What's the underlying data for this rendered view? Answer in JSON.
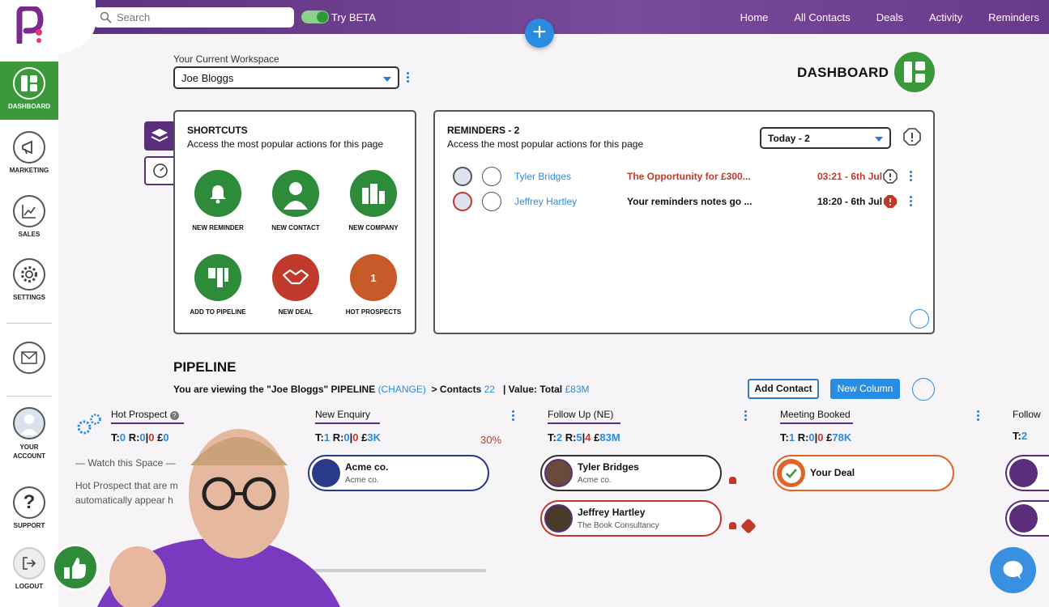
{
  "topbar": {
    "search_placeholder": "Search",
    "beta_label": "Try BETA",
    "nav": [
      "Home",
      "All Contacts",
      "Deals",
      "Activity",
      "Reminders"
    ],
    "add_label": "+"
  },
  "sidebar": {
    "items": [
      {
        "label": "DASHBOARD",
        "icon": "dashboard-icon",
        "active": true
      },
      {
        "label": "MARKETING",
        "icon": "megaphone-icon"
      },
      {
        "label": "SALES",
        "icon": "chart-line-icon"
      },
      {
        "label": "SETTINGS",
        "icon": "gear-icon"
      },
      {
        "label": "",
        "icon": "mail-icon"
      },
      {
        "label": "YOUR ACCOUNT",
        "icon": "avatar-icon"
      },
      {
        "label": "SUPPORT",
        "icon": "question-icon"
      },
      {
        "label": "LOGOUT",
        "icon": "logout-icon"
      }
    ]
  },
  "workspace": {
    "label": "Your Current Workspace",
    "value": "Joe Bloggs"
  },
  "dashboard": {
    "title": "DASHBOARD"
  },
  "shortcuts": {
    "title": "SHORTCUTS",
    "subtitle": "Access the most popular actions for this page",
    "items": [
      {
        "label": "NEW REMINDER",
        "icon": "bell-icon",
        "color": "#2e8b3a"
      },
      {
        "label": "NEW CONTACT",
        "icon": "person-icon",
        "color": "#2e8b3a"
      },
      {
        "label": "NEW COMPANY",
        "icon": "building-icon",
        "color": "#2e8b3a"
      },
      {
        "label": "ADD TO PIPELINE",
        "icon": "pipeline-icon",
        "color": "#2e8b3a"
      },
      {
        "label": "NEW DEAL",
        "icon": "handshake-icon",
        "color": "#c0392b"
      },
      {
        "label": "HOT PROSPECTS",
        "icon": "count-badge",
        "color": "#c85a2a",
        "count": "1"
      }
    ]
  },
  "reminders": {
    "title": "REMINDERS - 2",
    "subtitle": "Access the most popular actions for this page",
    "filter": "Today - 2",
    "rows": [
      {
        "name": "Tyler Bridges",
        "note": "The Opportunity for £300...",
        "time": "03:21 - 6th Jul",
        "note_color": "#c0392b",
        "time_color": "#c0392b"
      },
      {
        "name": "Jeffrey Hartley",
        "note": "Your reminders notes go ...",
        "time": "18:20 - 6th Jul",
        "note_color": "#111111",
        "time_color": "#111111"
      }
    ]
  },
  "pipeline": {
    "title": "PIPELINE",
    "sub_prefix": "You are viewing the \"Joe Bloggs\" PIPELINE",
    "change": "(CHANGE)",
    "contacts_label": ">   Contacts",
    "contacts_value": "22",
    "value_label": "|   Value: Total",
    "value_total": "£83M",
    "add_contact": "Add Contact",
    "new_column": "New Column",
    "columns": [
      {
        "name": "Hot Prospect",
        "t": "0",
        "r": "0",
        "r2": "0",
        "v": "0",
        "pct": ""
      },
      {
        "name": "New Enquiry",
        "t": "1",
        "r": "0",
        "r2": "0",
        "v": "3K",
        "pct": "30%"
      },
      {
        "name": "Follow Up (NE)",
        "t": "2",
        "r": "5",
        "r2": "4",
        "v": "83M",
        "pct": ""
      },
      {
        "name": "Meeting Booked",
        "t": "1",
        "r": "0",
        "r2": "0",
        "v": "78K",
        "pct": ""
      },
      {
        "name": "Follow",
        "t": "2",
        "r": "",
        "r2": "",
        "v": "",
        "pct": ""
      }
    ],
    "empty_title": "— Watch this Space —",
    "empty_text_1": "Hot Prospect that are m",
    "empty_text_2": "automatically appear h",
    "cards": {
      "acme_name": "Acme co.",
      "acme_company": "Acme co.",
      "tyler_name": "Tyler Bridges",
      "tyler_company": "Acme co.",
      "jeffrey_name": "Jeffrey Hartley",
      "jeffrey_company": "The Book Consultancy",
      "deal_name": "Your Deal"
    }
  },
  "colors": {
    "brand_purple": "#5a2e7a",
    "accent_blue": "#2a8ce0",
    "green": "#3a9a3a",
    "red": "#c0392b"
  }
}
